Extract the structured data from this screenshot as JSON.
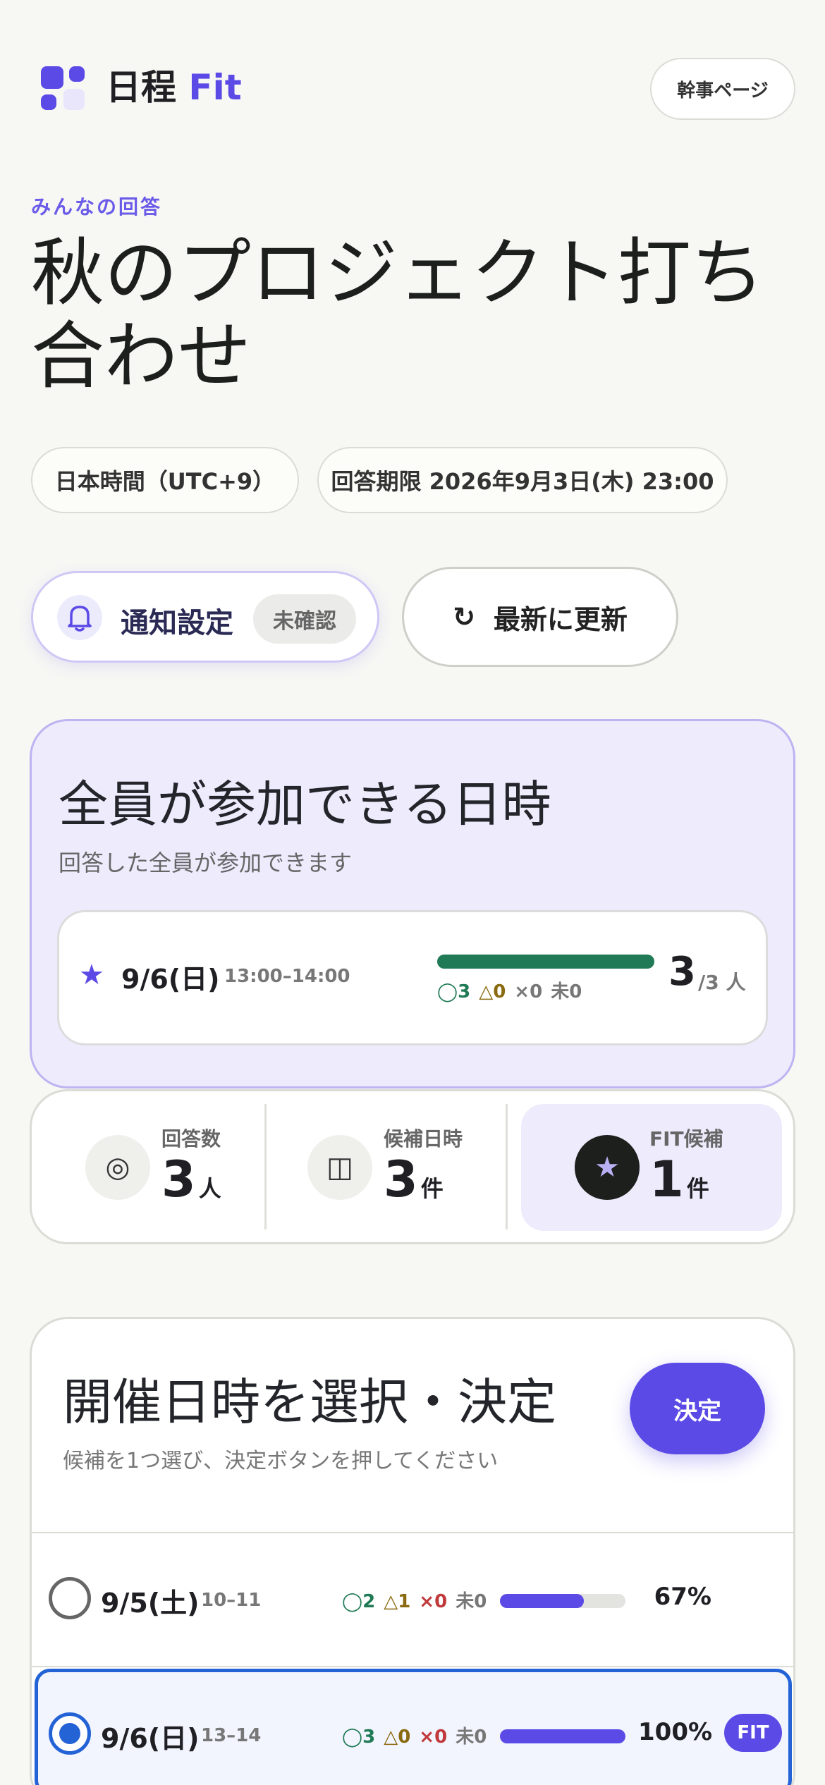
{
  "header": {
    "brand_main": "日程",
    "brand_accent": "Fit",
    "admin_button": "幹事ページ"
  },
  "event": {
    "eyebrow": "みんなの回答",
    "title": "秋のプロジェクト打ち合わせ",
    "timezone": "日本時間（UTC+9）",
    "deadline": "回答期限 2026年9月3日(木) 23:00"
  },
  "actions": {
    "notify_label": "通知設定",
    "notify_status": "未確認",
    "refresh_icon": "↻",
    "refresh_label": "最新に更新"
  },
  "fit_card": {
    "title": "全員が参加できる日時",
    "subtitle": "回答した全員が参加できます",
    "star": "★",
    "date": "9/6(日)",
    "time": "13:00–14:00",
    "ok": "◯3",
    "maybe": "△0",
    "no": "×0",
    "none": "未0",
    "count": "3",
    "total": "/3 人",
    "bar_fraction": 1.0
  },
  "stats": [
    {
      "icon": "◎",
      "label": "回答数",
      "value": "3",
      "unit": "人"
    },
    {
      "icon": "◫",
      "label": "候補日時",
      "value": "3",
      "unit": "件"
    },
    {
      "icon": "★",
      "label": "FIT候補",
      "value": "1",
      "unit": "件"
    }
  ],
  "select": {
    "title": "開催日時を選択・決定",
    "subtitle": "候補を1つ選び、決定ボタンを押してください",
    "decide_button": "決定",
    "candidates": [
      {
        "date": "9/5(土)",
        "time": "10–11",
        "ok": "◯2",
        "maybe": "△1",
        "no": "×0",
        "none": "未0",
        "percent": "67%",
        "fraction": 0.67,
        "selected": false,
        "fit": ""
      },
      {
        "date": "9/6(日)",
        "time": "13–14",
        "ok": "◯3",
        "maybe": "△0",
        "no": "×0",
        "none": "未0",
        "percent": "100%",
        "fraction": 1.0,
        "selected": true,
        "fit": "FIT"
      }
    ]
  },
  "colors": {
    "accent": "#5b4ae6",
    "ok": "#1f7a55",
    "selected_border": "#2463d6"
  }
}
